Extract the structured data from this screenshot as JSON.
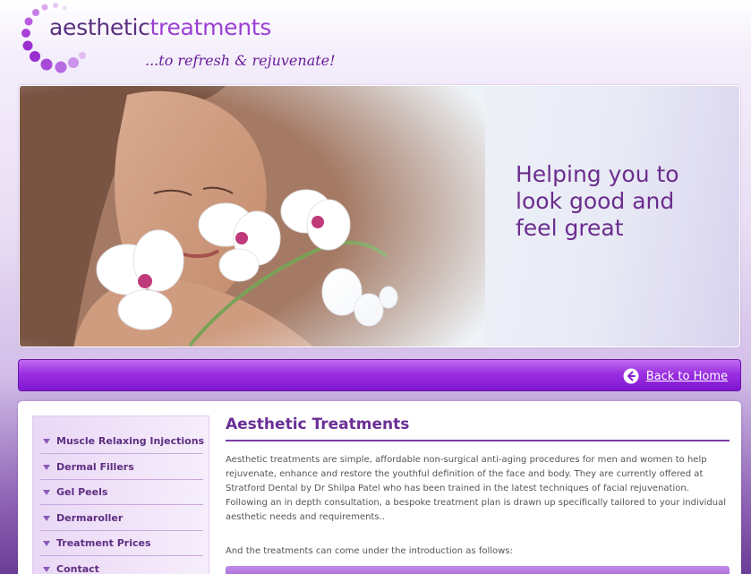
{
  "header": {
    "brand_part1": "aesthetic",
    "brand_part2": "treatments",
    "tagline": "...to refresh & rejuvenate!"
  },
  "hero": {
    "headline": "Helping you to look good and feel great"
  },
  "navbar": {
    "home_label": "Back to Home",
    "home_icon": "arrow-left-circle-icon"
  },
  "sidebar": {
    "items": [
      {
        "label": "Muscle Relaxing Injections"
      },
      {
        "label": "Dermal Fillers"
      },
      {
        "label": "Gel Peels"
      },
      {
        "label": "Dermaroller"
      },
      {
        "label": "Treatment Prices"
      },
      {
        "label": "Contact"
      }
    ]
  },
  "main": {
    "title": "Aesthetic Treatments",
    "paragraph": "Aesthetic treatments are simple, affordable non-surgical anti-aging procedures for men and women to help rejuvenate, enhance and restore the youthful definition of the face and body. They are currently offered at Stratford Dental by Dr Shilpa Patel who has been trained in the latest techniques of facial rejuvenation. Following an in depth consultation, a bespoke treatment plan is drawn up specifically tailored to your individual aesthetic needs and requirements..",
    "intro": "And the treatments can come under the introduction as follows:"
  },
  "colors": {
    "brand_dark": "#5a2f7e",
    "brand_accent": "#9b3fd3",
    "nav_purple": "#8116d2",
    "heading_purple": "#6a2f95"
  }
}
